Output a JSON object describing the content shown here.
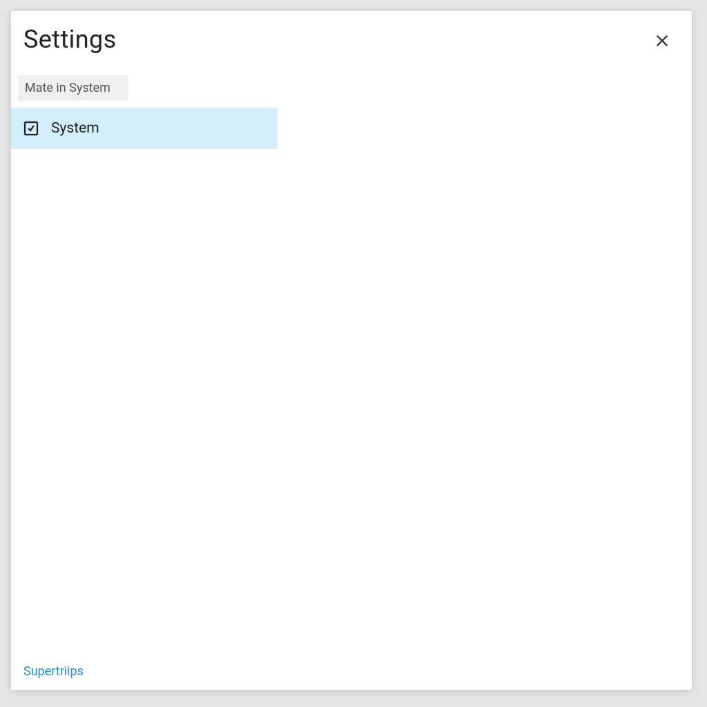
{
  "dialog": {
    "title": "Settings",
    "search": {
      "value": "Mate in System"
    },
    "nav": {
      "items": [
        {
          "label": "System",
          "icon": "gear-icon"
        }
      ]
    },
    "footer_link": "Supertriips"
  }
}
